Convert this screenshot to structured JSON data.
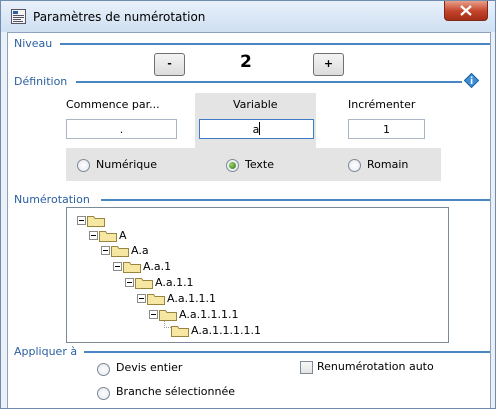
{
  "window": {
    "title": "Paramètres de numérotation"
  },
  "sections": {
    "niveau": "Niveau",
    "definition": "Définition",
    "numerotation": "Numérotation",
    "appliquer": "Appliquer à"
  },
  "level": {
    "minus": "-",
    "value": "2",
    "plus": "+"
  },
  "definition": {
    "start_label": "Commence par...",
    "start_value": ".",
    "variable_label": "Variable",
    "variable_value": "a",
    "increment_label": "Incrémenter",
    "increment_value": "1"
  },
  "format_options": [
    {
      "label": "Numérique",
      "selected": false
    },
    {
      "label": "Texte",
      "selected": true
    },
    {
      "label": "Romain",
      "selected": false
    }
  ],
  "tree": [
    "",
    "A",
    "A.a",
    "A.a.1",
    "A.a.1.1",
    "A.a.1.1.1",
    "A.a.1.1.1.1",
    "A.a.1.1.1.1.1"
  ],
  "apply": {
    "devis_entier": "Devis entier",
    "branche": "Branche sélectionnée",
    "renumerotation": "Renumérotation auto"
  },
  "colors": {
    "section_title": "#2b5fa0",
    "section_line": "#4a86c2",
    "radio_selected": "#2f7a12"
  }
}
